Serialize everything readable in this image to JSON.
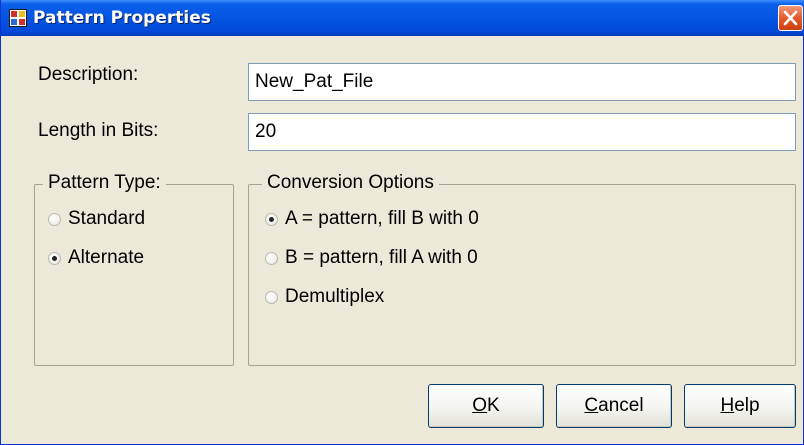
{
  "window": {
    "title": "Pattern Properties",
    "icons": {
      "app": "pattern-app-icon",
      "close": "close-icon"
    },
    "colors": {
      "titlebar": "#0554e3",
      "close_button": "#e5602f",
      "body": "#ece9d8"
    }
  },
  "fields": {
    "description": {
      "label": "Description:",
      "value": "New_Pat_File"
    },
    "length": {
      "label": "Length in Bits:",
      "value": "20"
    }
  },
  "pattern_type": {
    "legend": "Pattern Type:",
    "options": [
      {
        "label": "Standard",
        "checked": false
      },
      {
        "label": "Alternate",
        "checked": true
      }
    ]
  },
  "conversion": {
    "legend": "Conversion Options",
    "options": [
      {
        "label": "A = pattern, fill B with 0",
        "checked": true
      },
      {
        "label": "B = pattern, fill A with 0",
        "checked": false
      },
      {
        "label": "Demultiplex",
        "checked": false
      }
    ]
  },
  "buttons": {
    "ok": {
      "mnemonic": "O",
      "rest": "K"
    },
    "cancel": {
      "mnemonic": "C",
      "rest": "ancel"
    },
    "help": {
      "mnemonic": "H",
      "rest": "elp"
    }
  }
}
